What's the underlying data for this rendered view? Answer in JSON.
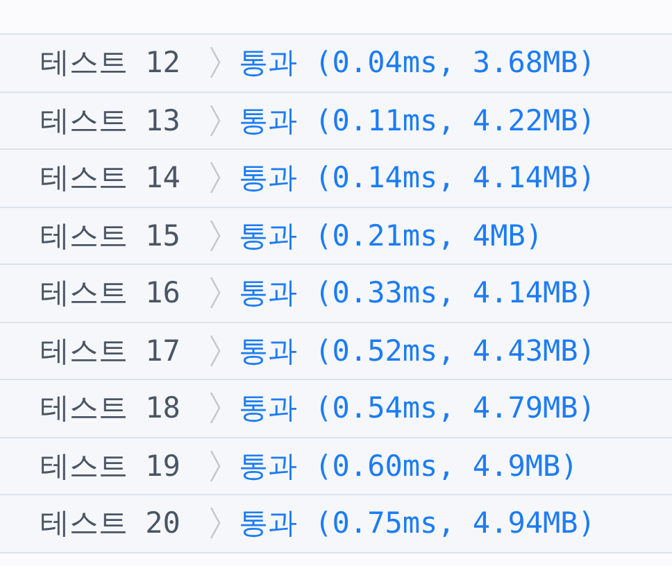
{
  "test_results": [
    {
      "label": "테스트 12",
      "result": "통과 (0.04ms, 3.68MB)"
    },
    {
      "label": "테스트 13",
      "result": "통과 (0.11ms, 4.22MB)"
    },
    {
      "label": "테스트 14",
      "result": "통과 (0.14ms, 4.14MB)"
    },
    {
      "label": "테스트 15",
      "result": "통과 (0.21ms, 4MB)"
    },
    {
      "label": "테스트 16",
      "result": "통과 (0.33ms, 4.14MB)"
    },
    {
      "label": "테스트 17",
      "result": "통과 (0.52ms, 4.43MB)"
    },
    {
      "label": "테스트 18",
      "result": "통과 (0.54ms, 4.79MB)"
    },
    {
      "label": "테스트 19",
      "result": "통과 (0.60ms, 4.9MB)"
    },
    {
      "label": "테스트 20",
      "result": "통과 (0.75ms, 4.94MB)"
    }
  ]
}
